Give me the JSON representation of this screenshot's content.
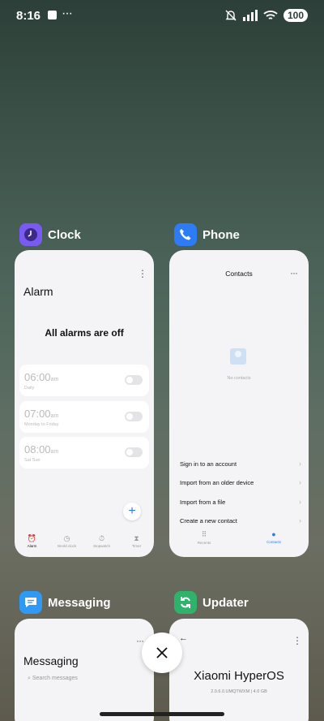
{
  "status_bar": {
    "time": "8:16",
    "dots": "···",
    "battery": "100"
  },
  "clock": {
    "app_name": "Clock",
    "title": "Alarm",
    "empty_message": "All alarms are off",
    "alarms": [
      {
        "time": "06:00",
        "ampm": "am",
        "repeat": "Daily",
        "enabled": false
      },
      {
        "time": "07:00",
        "ampm": "am",
        "repeat": "Monday to Friday",
        "enabled": false
      },
      {
        "time": "08:00",
        "ampm": "am",
        "repeat": "Sat Sun",
        "enabled": false
      }
    ],
    "fab": "+",
    "tabs": [
      "Alarm",
      "World clock",
      "Stopwatch",
      "Timer"
    ]
  },
  "phone": {
    "app_name": "Phone",
    "title": "Contacts",
    "empty_message": "No contacts",
    "actions": [
      "Sign in to an account",
      "Import from an older device",
      "Import from a file",
      "Create a new contact"
    ],
    "tabs": [
      "Recents",
      "Contacts"
    ]
  },
  "messaging": {
    "app_name": "Messaging",
    "title": "Messaging",
    "search_placeholder": "Search messages"
  },
  "updater": {
    "app_name": "Updater",
    "brand": "Xiaomi HyperOS",
    "version": "2.0.6.0.UMQTWXM | 4.0 GB"
  },
  "close_button": "×",
  "icons": {
    "clock": "clock-icon",
    "phone": "phone-icon",
    "messaging": "message-icon",
    "updater": "refresh-icon"
  }
}
